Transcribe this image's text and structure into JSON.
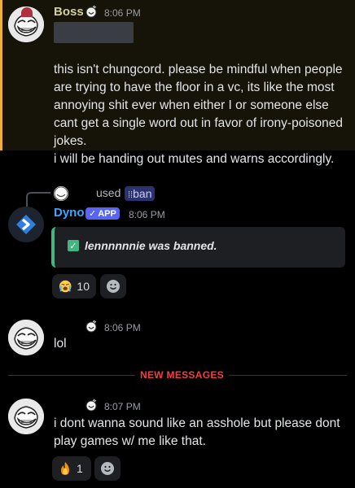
{
  "messages": {
    "m1": {
      "author": "Boss",
      "time": "8:06 PM",
      "lines": [
        "this isn't chungcord. please be mindful when people",
        "are trying to have the floor in a vc, its like the most",
        "annoying shit ever when either I or someone else",
        "cant get a single word out in favor of irony-poisoned",
        "jokes."
      ],
      "followup": "i will be handing out mutes and warns accordingly."
    },
    "m2": {
      "reply_used": "used",
      "command": "ban",
      "author": "Dyno",
      "app_tag": "APP",
      "time": "8:06 PM",
      "embed_text": "lennnnnnie was banned.",
      "reaction_count": "10"
    },
    "m3": {
      "time": "8:06 PM",
      "text": "lol"
    },
    "new_messages_label": "NEW MESSAGES",
    "m4": {
      "time": "8:07 PM",
      "lines": [
        "i dont wanna sound like an asshole but please dont",
        "play games w/ me like that."
      ],
      "reaction_count": "1"
    }
  },
  "colors": {
    "accent": "#5865f2",
    "highlight_bar": "#f0b232",
    "embed_bar": "#43b581",
    "new_messages": "#f23f43",
    "dyno_name": "#3aa6ff"
  }
}
